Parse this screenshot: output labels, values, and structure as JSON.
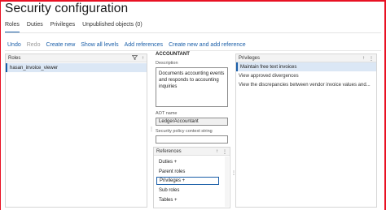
{
  "app": {
    "title": "Security configuration"
  },
  "tabs": [
    {
      "label": "Roles",
      "active": true
    },
    {
      "label": "Duties",
      "active": false
    },
    {
      "label": "Privileges",
      "active": false
    },
    {
      "label": "Unpublished objects (0)",
      "active": false
    }
  ],
  "actions": [
    {
      "label": "Undo",
      "enabled": true
    },
    {
      "label": "Redo",
      "enabled": false
    },
    {
      "label": "Create new",
      "enabled": true
    },
    {
      "label": "Show all levels",
      "enabled": true
    },
    {
      "label": "Add references",
      "enabled": true
    },
    {
      "label": "Create new and add reference",
      "enabled": true
    }
  ],
  "roles_panel": {
    "header": "Roles",
    "items": [
      "hasan_invoice_viewer"
    ]
  },
  "detail": {
    "heading": "ACCOUNTANT",
    "description_label": "Description",
    "description_value": "Documents accounting events and responds to accounting inquiries",
    "aot_label": "AOT name",
    "aot_value": "LedgerAccountant",
    "context_label": "Security policy context string",
    "context_value": ""
  },
  "references": {
    "header": "References",
    "items": [
      {
        "label": "Duties +",
        "selected": false
      },
      {
        "label": "Parent roles",
        "selected": false
      },
      {
        "label": "Privileges +",
        "selected": true
      },
      {
        "label": "Sub roles",
        "selected": false
      },
      {
        "label": "Tables +",
        "selected": false
      }
    ]
  },
  "privileges_panel": {
    "header": "Privileges",
    "items": [
      {
        "label": "Maintain free text invoices",
        "selected": true
      },
      {
        "label": "View approved divergences",
        "selected": false
      },
      {
        "label": "View the discrepancies between vendor invoice values and...",
        "selected": false
      }
    ]
  },
  "colors": {
    "accent": "#1a5ea8",
    "frame": "#e81123",
    "selection": "#dbe7f5"
  }
}
